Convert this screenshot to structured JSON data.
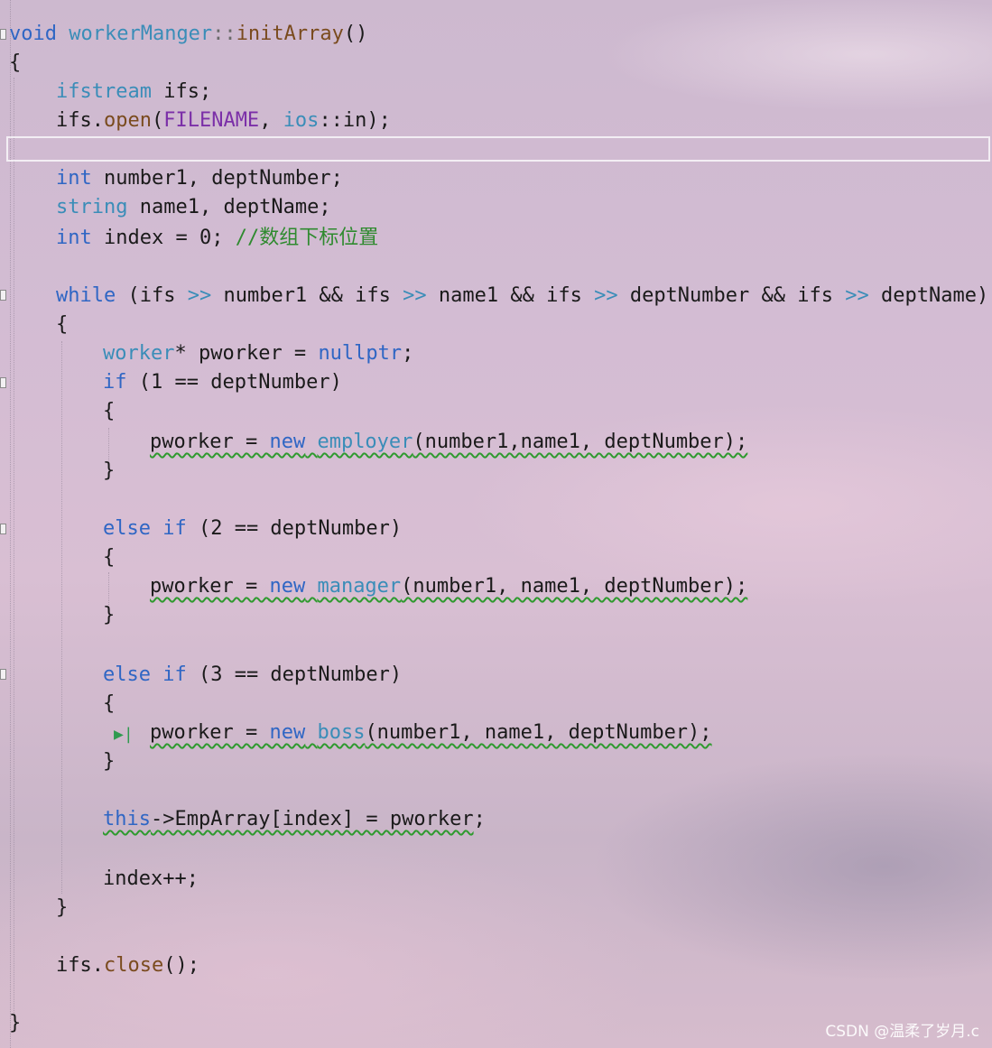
{
  "code": {
    "l1": [
      "void",
      " ",
      "workerManger",
      "::",
      "initArray",
      "()"
    ],
    "l2": "{",
    "l3": [
      "ifstream",
      " ifs;"
    ],
    "l4": [
      "ifs.",
      "open",
      "(",
      "FILENAME",
      ", ",
      "ios",
      "::in);"
    ],
    "l5": [
      "int",
      " number1, deptNumber;"
    ],
    "l6": [
      "string",
      " name1, deptName;"
    ],
    "l7": [
      "int",
      " index = 0; ",
      "//数组下标位置"
    ],
    "l8": [
      "while",
      " (ifs ",
      ">>",
      " number1 && ifs ",
      ">>",
      " name1 && ifs ",
      ">>",
      " deptNumber && ifs ",
      ">>",
      " deptName)"
    ],
    "l9": "{",
    "l10": [
      "worker",
      "* pworker = ",
      "nullptr",
      ";"
    ],
    "l11": [
      "if",
      " (1 == deptNumber)"
    ],
    "l12": "{",
    "l13": [
      "pworker = ",
      "new",
      " ",
      "employer",
      "(number1,name1, deptNumber);"
    ],
    "l14": "}",
    "l15": [
      "else if",
      " (2 == deptNumber)"
    ],
    "l16": "{",
    "l17": [
      "pworker = ",
      "new",
      " ",
      "manager",
      "(number1, name1, deptNumber);"
    ],
    "l18": "}",
    "l19": [
      "else if",
      " (3 == deptNumber)"
    ],
    "l20": "{",
    "l21": [
      "pworker = ",
      "new",
      " ",
      "boss",
      "(number1, name1, deptNumber);"
    ],
    "l22": "}",
    "l23": [
      "this",
      "->EmpArray[index] = pworker",
      ";"
    ],
    "l24": "index++;",
    "l25": "}",
    "l26": [
      "ifs.",
      "close",
      "();"
    ],
    "l27": "}"
  },
  "breakpoint_glyph": "▶|",
  "watermark": "CSDN @温柔了岁月.c"
}
